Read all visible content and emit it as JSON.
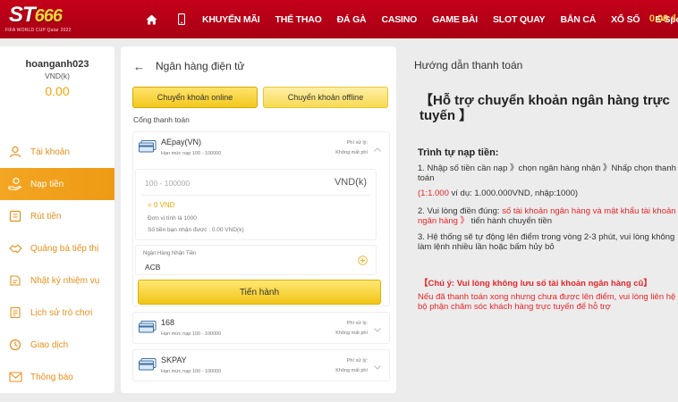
{
  "header": {
    "logo_main": "ST",
    "logo_num": "666",
    "logo_sub": "FIFA WORLD CUP Qatar 2022",
    "nav": [
      "KHUYẾN MÃI",
      "THỂ THAO",
      "ĐÁ GÀ",
      "CASINO",
      "GAME BÀI",
      "SLOT QUAY",
      "BẮN CÁ",
      "XỔ SỐ",
      "E-Sports"
    ],
    "balance": "0.00 ₫",
    "icons": [
      "home-icon",
      "mobile-icon"
    ]
  },
  "user": {
    "name": "hoanganh023",
    "currency": "VND(k)",
    "balance": "0.00"
  },
  "sidebar": {
    "items": [
      {
        "label": "Tài khoản",
        "icon": "user-icon",
        "active": false
      },
      {
        "label": "Nạp tiền",
        "icon": "deposit-hand-icon",
        "active": true
      },
      {
        "label": "Rút tiền",
        "icon": "withdraw-icon",
        "active": false
      },
      {
        "label": "Quảng bá tiếp thị",
        "icon": "handshake-icon",
        "active": false
      },
      {
        "label": "Nhật ký nhiệm vụ",
        "icon": "mission-log-icon",
        "active": false
      },
      {
        "label": "Lịch sử trò chơi",
        "icon": "game-history-icon",
        "active": false
      },
      {
        "label": "Giao dịch",
        "icon": "transaction-clock-icon",
        "active": false
      },
      {
        "label": "Thông báo",
        "icon": "mail-icon",
        "active": false
      }
    ]
  },
  "deposit": {
    "title": "Ngân hàng điện tử",
    "tab_online": "Chuyển khoản online",
    "tab_offline": "Chuyển khoản offline",
    "gate_label": "Cổng thanh toán",
    "banks": [
      {
        "name": "AEpay(VN)",
        "limit": "Hạn mức nạp 100 - 100000",
        "fee1": "Phí xử lý:",
        "fee2": "Không mất phí"
      },
      {
        "name": "168",
        "limit": "Hạn mức nạp 100 - 100000",
        "fee1": "Phí xử lý:",
        "fee2": "Không mất phí"
      },
      {
        "name": "SKPAY",
        "limit": "Hạn mức nạp 100 - 100000",
        "fee1": "Phí xử lý:",
        "fee2": "Không mất phí"
      }
    ],
    "amount_placeholder": "100 - 100000",
    "amount_unit": "VND(k)",
    "converted": "= 0 VND",
    "rate_note": "Đơn vị tính là 1000",
    "receive_note": "Số tiền bạn nhận được : 0.00 VND(k)",
    "recv_bank_label": "Ngân Hàng Nhận Tiền",
    "recv_bank_value": "ACB",
    "submit": "Tiến hành"
  },
  "guide": {
    "title": "Hướng dẫn thanh toán",
    "heading": "【Hỗ trợ chuyển khoản ngân hàng trực tuyến 】",
    "steps_title": "Trình tự nạp tiền:",
    "step1": "1. Nhập số tiền cần nạp 》chọn ngân hàng nhận 》Nhấp chọn thanh toán",
    "step1_note_red": "(1:1.000",
    "step1_note": " ví dụ: 1.000.000VND, nhập:1000)",
    "step2_a": "2. Vui lòng điền đúng: ",
    "step2_red": "số tài khoản ngân hàng và mật khẩu tài khoản ngân hàng 》",
    "step2_b": " tiến hành chuyển tiền",
    "step3": "3. Hệ thống sẽ tự động lên điểm trong vòng 2-3 phút, vui lòng không làm lệnh nhiều lần hoặc bấm hủy bỏ",
    "warn1": "【Chú ý: Vui lòng không lưu số tài khoản ngân hàng cũ】",
    "warn2": "Nếu đã thanh toán xong nhưng chưa được lên điểm, vui lòng liên hệ bộ phận chăm sóc khách hàng trực tuyến để hỗ trợ"
  },
  "colors": {
    "brand_red": "#b8001a",
    "accent_orange": "#f3a622",
    "gold": "#f1c517",
    "warning_red": "#e5262a"
  }
}
